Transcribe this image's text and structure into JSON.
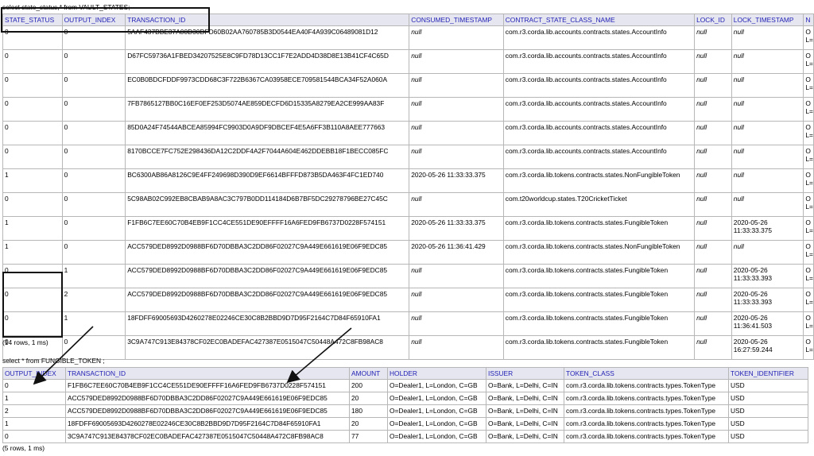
{
  "query1": {
    "sql": "select state_status,* from VAULT_STATES;",
    "rows_label": "(14 rows, 1 ms)"
  },
  "vault_states": {
    "headers": [
      "STATE_STATUS",
      "OUTPUT_INDEX",
      "TRANSACTION_ID",
      "CONSUMED_TIMESTAMP",
      "CONTRACT_STATE_CLASS_NAME",
      "LOCK_ID",
      "LOCK_TIMESTAMP",
      "N"
    ],
    "rows": [
      [
        "0",
        "0",
        "5AAF437BBE37A00D30DFD60B02AA760785B3D0544EA40F4A939C06489081D12",
        "null",
        "com.r3.corda.lib.accounts.contracts.states.AccountInfo",
        "null",
        "null",
        "O\nL="
      ],
      [
        "0",
        "0",
        "D67FC59736A1FBED34207525E8C9FD78D13CC1F7E2ADD4D38D8E13B41CF4C65D",
        "null",
        "com.r3.corda.lib.accounts.contracts.states.AccountInfo",
        "null",
        "null",
        "O\nL="
      ],
      [
        "0",
        "0",
        "EC0B0BDCFDDF9973CDD68C3F722B6367CA03958ECE709581544BCA34F52A060A",
        "null",
        "com.r3.corda.lib.accounts.contracts.states.AccountInfo",
        "null",
        "null",
        "O\nL="
      ],
      [
        "0",
        "0",
        "7FB7865127BB0C16EF0EF253D5074AE859DECFD6D15335A8279EA2CE999AA83F",
        "null",
        "com.r3.corda.lib.accounts.contracts.states.AccountInfo",
        "null",
        "null",
        "O\nL="
      ],
      [
        "0",
        "0",
        "85D0A24F74544ABCEA85994FC9903D0A9DF9DBCEF4E5A6FF3B110A8AEE777663",
        "null",
        "com.r3.corda.lib.accounts.contracts.states.AccountInfo",
        "null",
        "null",
        "O\nL="
      ],
      [
        "0",
        "0",
        "8170BCCE7FC752E298436DA12C2DDF4A2F7044A604E462DDEBB18F1BECC085FC",
        "null",
        "com.r3.corda.lib.accounts.contracts.states.AccountInfo",
        "null",
        "null",
        "O\nL="
      ],
      [
        "1",
        "0",
        "BC6300AB86A8126C9E4FF249698D390D9EF6614BFFFD873B5DA463F4FC1ED740",
        "2020-05-26 11:33:33.375",
        "com.r3.corda.lib.tokens.contracts.states.NonFungibleToken",
        "null",
        "null",
        "O\nL="
      ],
      [
        "0",
        "0",
        "5C98AB02C992EB8CBAB9A8AC3C797B0DD114184D6B7BF5DC29278796BE27C45C",
        "null",
        "com.t20worldcup.states.T20CricketTicket",
        "null",
        "null",
        "O\nL="
      ],
      [
        "1",
        "0",
        "F1FB6C7EE60C70B4EB9F1CC4CE551DE90EFFFF16A6FED9FB6737D0228F574151",
        "2020-05-26 11:33:33.375",
        "com.r3.corda.lib.tokens.contracts.states.FungibleToken",
        "null",
        "2020-05-26\n11:33:33.375",
        "O\nL="
      ],
      [
        "1",
        "0",
        "ACC579DED8992D0988BF6D70DBBA3C2DD86F02027C9A449E661619E06F9EDC85",
        "2020-05-26 11:36:41.429",
        "com.r3.corda.lib.tokens.contracts.states.NonFungibleToken",
        "null",
        "null",
        "O\nL="
      ],
      [
        "0",
        "1",
        "ACC579DED8992D0988BF6D70DBBA3C2DD86F02027C9A449E661619E06F9EDC85",
        "null",
        "com.r3.corda.lib.tokens.contracts.states.FungibleToken",
        "null",
        "2020-05-26\n11:33:33.393",
        "O\nL="
      ],
      [
        "0",
        "2",
        "ACC579DED8992D0988BF6D70DBBA3C2DD86F02027C9A449E661619E06F9EDC85",
        "null",
        "com.r3.corda.lib.tokens.contracts.states.FungibleToken",
        "null",
        "2020-05-26\n11:33:33.393",
        "O\nL="
      ],
      [
        "0",
        "1",
        "18FDFF69005693D4260278E02246CE30C8B2BBD9D7D95F2164C7D84F65910FA1",
        "null",
        "com.r3.corda.lib.tokens.contracts.states.FungibleToken",
        "null",
        "2020-05-26\n11:36:41.503",
        "O\nL="
      ],
      [
        "0",
        "0",
        "3C9A747C913E84378CF02EC0BADEFAC427387E0515047C50448A472C8FB98AC8",
        "null",
        "com.r3.corda.lib.tokens.contracts.states.FungibleToken",
        "null",
        "2020-05-26\n16:27:59.244",
        "O\nL="
      ]
    ]
  },
  "query2": {
    "sql": "select * from FUNGIBLE_TOKEN ;",
    "rows_label": "(5 rows, 1 ms)"
  },
  "fungible_token": {
    "headers": [
      "OUTPUT_INDEX",
      "TRANSACTION_ID",
      "AMOUNT",
      "HOLDER",
      "ISSUER",
      "TOKEN_CLASS",
      "TOKEN_IDENTIFIER"
    ],
    "rows": [
      [
        "0",
        "F1FB6C7EE60C70B4EB9F1CC4CE551DE90EFFFF16A6FED9FB6737D0228F574151",
        "200",
        "O=Dealer1, L=London, C=GB",
        "O=Bank, L=Delhi, C=IN",
        "com.r3.corda.lib.tokens.contracts.types.TokenType",
        "USD"
      ],
      [
        "1",
        "ACC579DED8992D0988BF6D70DBBA3C2DD86F02027C9A449E661619E06F9EDC85",
        "20",
        "O=Dealer1, L=London, C=GB",
        "O=Bank, L=Delhi, C=IN",
        "com.r3.corda.lib.tokens.contracts.types.TokenType",
        "USD"
      ],
      [
        "2",
        "ACC579DED8992D0988BF6D70DBBA3C2DD86F02027C9A449E661619E06F9EDC85",
        "180",
        "O=Dealer1, L=London, C=GB",
        "O=Bank, L=Delhi, C=IN",
        "com.r3.corda.lib.tokens.contracts.types.TokenType",
        "USD"
      ],
      [
        "1",
        "18FDFF69005693D4260278E02246CE30C8B2BBD9D7D95F2164C7D84F65910FA1",
        "20",
        "O=Dealer1, L=London, C=GB",
        "O=Bank, L=Delhi, C=IN",
        "com.r3.corda.lib.tokens.contracts.types.TokenType",
        "USD"
      ],
      [
        "0",
        "3C9A747C913E84378CF02EC0BADEFAC427387E0515047C50448A472C8FB98AC8",
        "77",
        "O=Dealer1, L=London, C=GB",
        "O=Bank, L=Delhi, C=IN",
        "com.r3.corda.lib.tokens.contracts.types.TokenType",
        "USD"
      ]
    ]
  },
  "colors": {
    "header_text": "#1f1fb5",
    "header_bg": "#e6e6f0",
    "grid": "#b7b7b7",
    "annotation": "#111111"
  }
}
